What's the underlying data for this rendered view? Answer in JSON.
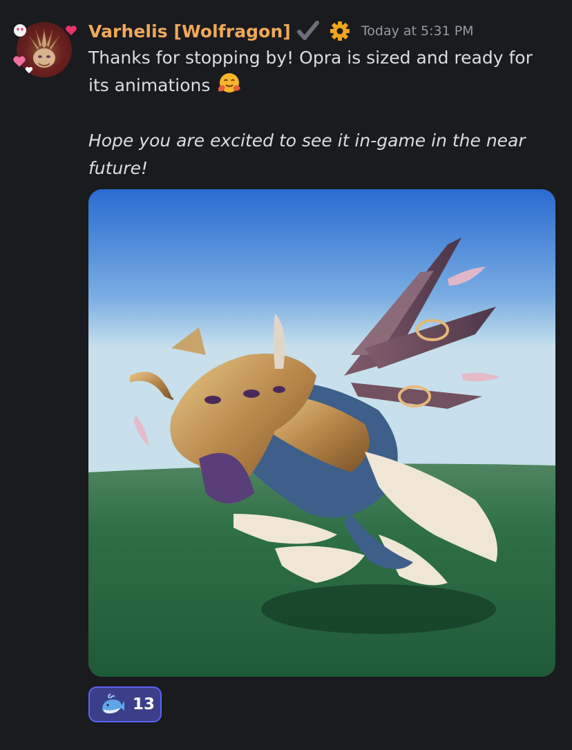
{
  "message": {
    "author": {
      "username": "Varhelis [Wolfragon]",
      "name_color": "#f0a959",
      "badges": [
        "checkmark-icon",
        "gear-icon"
      ]
    },
    "timestamp": "Today at 5:31 PM",
    "text_line_1": "Thanks for stopping by! Opra is sized and ready for its animations",
    "text_emoji": "hugging-face-emoji",
    "text_line_2": "Hope you are excited to see it in-game in the near future!",
    "attachment": {
      "type": "image",
      "description_icon": "creature-render-image"
    },
    "reactions": [
      {
        "emoji": "whale-emoji",
        "count": "13",
        "reacted": true
      }
    ]
  },
  "colors": {
    "background": "#1a1b1e",
    "text": "#dbdee1",
    "muted": "#949ba4",
    "accent": "#5865f2"
  }
}
